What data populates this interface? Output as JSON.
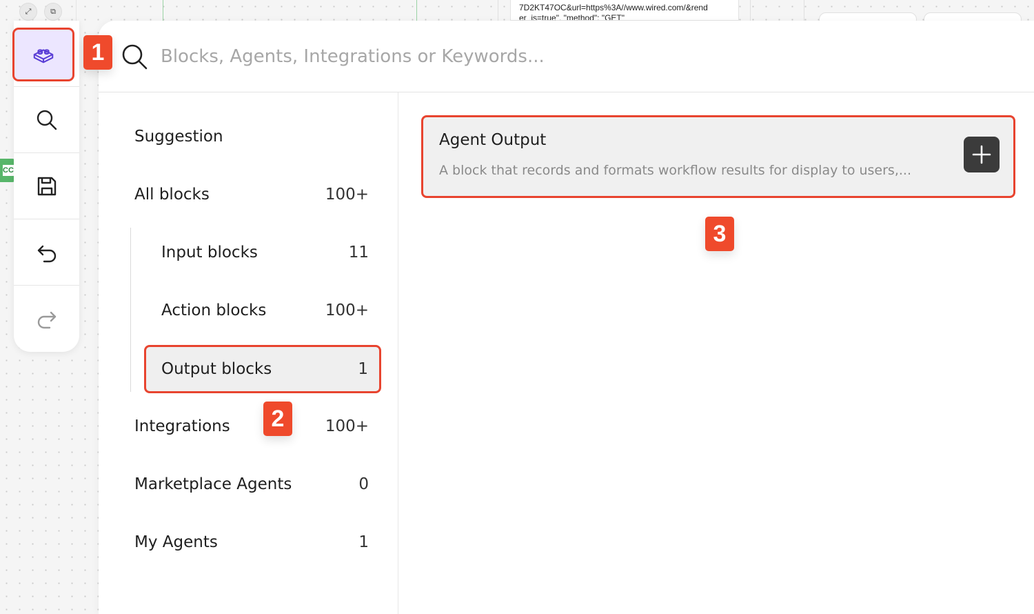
{
  "background": {
    "node_text_line1": "7D2KT47OC&url=https%3A//www.wired.com/&rend",
    "node_text_line2": "er_js=true\", \"method\": \"GET\"",
    "tag_text": "CC"
  },
  "toolbar": {
    "items": [
      {
        "name": "blocks",
        "icon": "lego-block-icon",
        "active": true
      },
      {
        "name": "search",
        "icon": "search-icon"
      },
      {
        "name": "save",
        "icon": "save-icon"
      },
      {
        "name": "undo",
        "icon": "undo-icon"
      },
      {
        "name": "redo",
        "icon": "redo-icon"
      }
    ]
  },
  "badges": {
    "one": "1",
    "two": "2",
    "three": "3"
  },
  "search": {
    "placeholder": "Blocks, Agents, Integrations or Keywords..."
  },
  "nav": {
    "suggestion": "Suggestion",
    "all_blocks": {
      "label": "All blocks",
      "count": "100+"
    },
    "input_blocks": {
      "label": "Input blocks",
      "count": "11"
    },
    "action_blocks": {
      "label": "Action blocks",
      "count": "100+"
    },
    "output_blocks": {
      "label": "Output blocks",
      "count": "1"
    },
    "integrations": {
      "label": "Integrations",
      "count": "100+"
    },
    "marketplace_agents": {
      "label": "Marketplace Agents",
      "count": "0"
    },
    "my_agents": {
      "label": "My Agents",
      "count": "1"
    }
  },
  "results": [
    {
      "title": "Agent Output",
      "description": "A block that records and formats workflow results for display to users,..."
    }
  ],
  "colors": {
    "highlight": "#e8442f",
    "accent_purple": "#5b3fd6",
    "add_button": "#3b3b3b"
  }
}
